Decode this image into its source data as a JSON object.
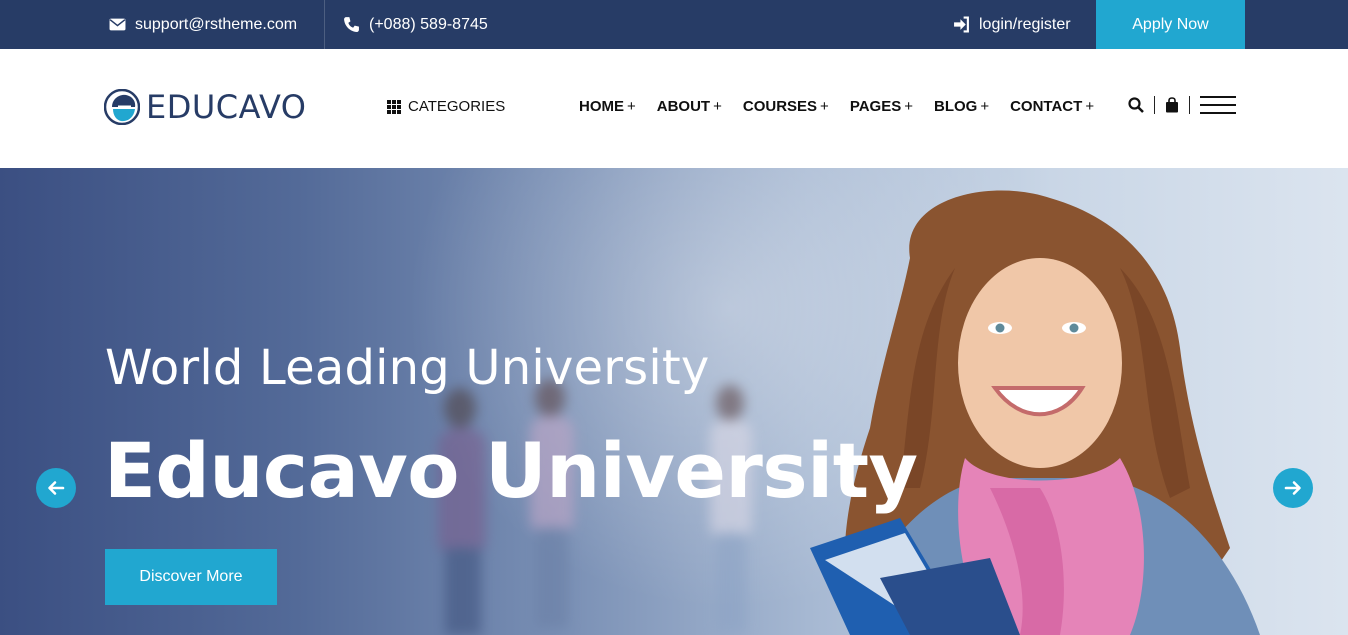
{
  "topbar": {
    "email": "support@rstheme.com",
    "phone": "(+088) 589-8745",
    "login": "login/register",
    "apply": "Apply Now"
  },
  "header": {
    "logo_text": "EDUCAVO",
    "categories": "CATEGORIES",
    "nav": [
      "HOME",
      "ABOUT",
      "COURSES",
      "PAGES",
      "BLOG",
      "CONTACT"
    ],
    "nav_suffix": "+"
  },
  "hero": {
    "subtitle": "World Leading University",
    "title": "Educavo University",
    "cta": "Discover More"
  },
  "colors": {
    "topbar_bg": "#273c66",
    "accent": "#21a7d0",
    "brand_text": "#273c66"
  },
  "icons": [
    "envelope-icon",
    "phone-icon",
    "sign-in-icon",
    "grid-icon",
    "search-icon",
    "shopping-bag-icon",
    "hamburger-menu-icon",
    "arrow-left-icon",
    "arrow-right-icon"
  ]
}
